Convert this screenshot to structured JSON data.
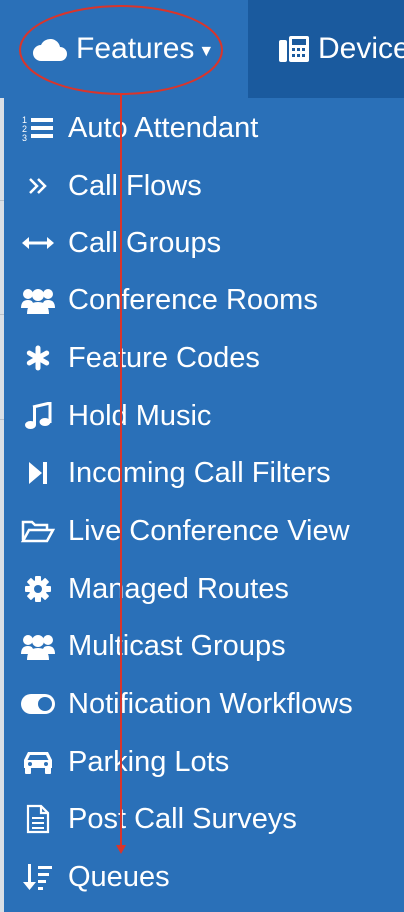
{
  "nav": {
    "features": {
      "label": "Features",
      "icon": "cloud-icon"
    },
    "devices": {
      "label": "Devices",
      "icon": "fax-icon"
    }
  },
  "menu": {
    "items": [
      {
        "label": "Auto Attendant",
        "icon": "list-ol-icon"
      },
      {
        "label": "Call Flows",
        "icon": "angle-double-right-icon"
      },
      {
        "label": "Call Groups",
        "icon": "arrows-h-icon"
      },
      {
        "label": "Conference Rooms",
        "icon": "users-icon"
      },
      {
        "label": "Feature Codes",
        "icon": "asterisk-icon"
      },
      {
        "label": "Hold Music",
        "icon": "music-icon"
      },
      {
        "label": "Incoming Call Filters",
        "icon": "step-forward-icon"
      },
      {
        "label": "Live Conference View",
        "icon": "folder-open-icon"
      },
      {
        "label": "Managed Routes",
        "icon": "cog-icon"
      },
      {
        "label": "Multicast Groups",
        "icon": "users-icon"
      },
      {
        "label": "Notification Workflows",
        "icon": "toggle-on-icon"
      },
      {
        "label": "Parking Lots",
        "icon": "car-icon"
      },
      {
        "label": "Post Call Surveys",
        "icon": "file-text-icon"
      },
      {
        "label": "Queues",
        "icon": "sort-amount-icon"
      }
    ]
  },
  "colors": {
    "menu_bg": "#2a70b8",
    "devices_bg": "#1a5a9e",
    "text": "#ffffff",
    "annotation": "#d9352b"
  }
}
